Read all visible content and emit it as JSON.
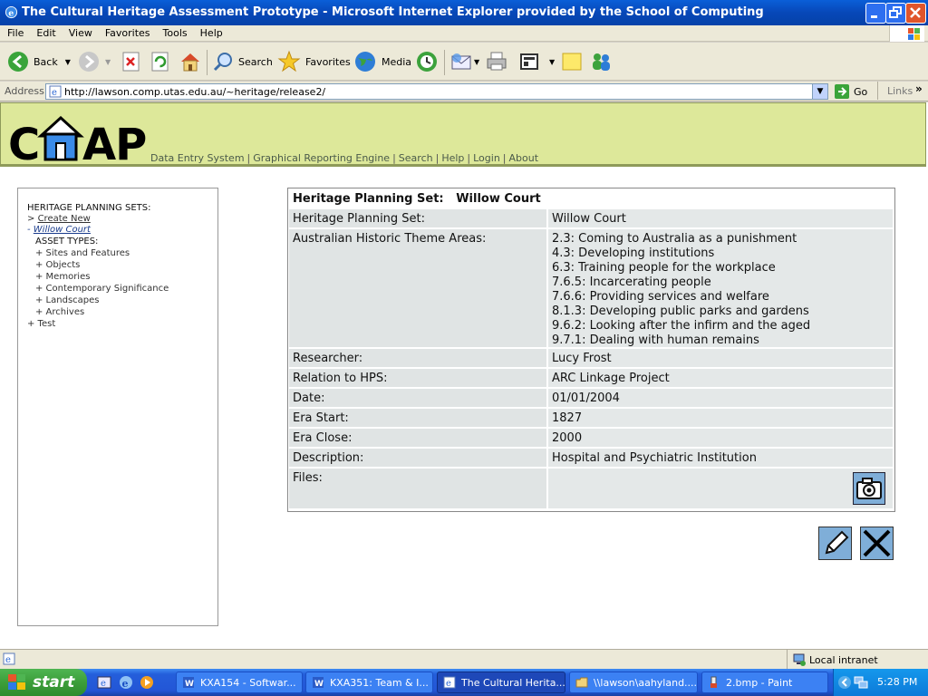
{
  "window": {
    "title": "The Cultural Heritage Assessment Prototype - Microsoft Internet Explorer provided by the School of Computing"
  },
  "menu": [
    "File",
    "Edit",
    "View",
    "Favorites",
    "Tools",
    "Help"
  ],
  "toolbar": {
    "back": "Back",
    "search": "Search",
    "favorites": "Favorites",
    "media": "Media"
  },
  "address": {
    "label": "Address",
    "url": "http://lawson.comp.utas.edu.au/~heritage/release2/",
    "go": "Go",
    "links": "Links"
  },
  "site": {
    "logo": "CHAP",
    "nav": [
      "Data Entry System",
      "Graphical Reporting Engine",
      "Search",
      "Help",
      "Login",
      "About"
    ]
  },
  "sidebar": {
    "heading": "HERITAGE PLANNING SETS:",
    "create_new": "Create New",
    "create_prefix": ">",
    "current_prefix": "-",
    "current": "Willow Court",
    "asset_types_heading": "ASSET TYPES:",
    "asset_types": [
      "+ Sites and Features",
      "+ Objects",
      "+ Memories",
      "+ Contemporary Significance",
      "+ Landscapes",
      "+ Archives"
    ],
    "other_sets": [
      "+ Test"
    ]
  },
  "record": {
    "header_label": "Heritage Planning Set:",
    "header_value": "Willow Court",
    "rows": [
      {
        "label": "Heritage Planning Set:",
        "value": "Willow Court"
      },
      {
        "label": "Australian Historic Theme Areas:"
      },
      {
        "label": "Researcher:",
        "value": "Lucy Frost"
      },
      {
        "label": "Relation to HPS:",
        "value": "ARC Linkage Project"
      },
      {
        "label": "Date:",
        "value": "01/01/2004"
      },
      {
        "label": "Era Start:",
        "value": "1827"
      },
      {
        "label": "Era Close:",
        "value": "2000"
      },
      {
        "label": "Description:",
        "value": "Hospital and Psychiatric Institution"
      },
      {
        "label": "Files:",
        "value": ""
      }
    ],
    "themes": [
      "2.3: Coming to Australia as a punishment",
      "4.3: Developing institutions",
      "6.3: Training people for the workplace",
      "7.6.5: Incarcerating people",
      "7.6.6: Providing services and welfare",
      "8.1.3: Developing public parks and gardens",
      "9.6.2: Looking after the infirm and the aged",
      "9.7.1: Dealing with human remains"
    ]
  },
  "status": {
    "zone": "Local intranet"
  },
  "taskbar": {
    "start": "start",
    "tasks": [
      "KXA154 - Softwar...",
      "KXA351: Team & I...",
      "The Cultural Herita...",
      "\\\\lawson\\aahyland....",
      "2.bmp - Paint"
    ],
    "clock": "5:28 PM"
  }
}
